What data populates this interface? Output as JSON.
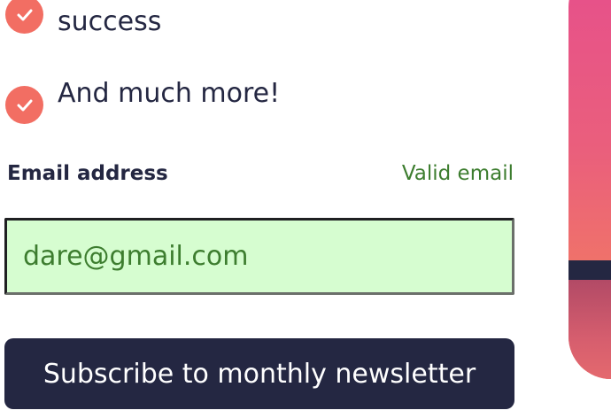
{
  "features": [
    {
      "text": "success"
    },
    {
      "text": "And much more!"
    }
  ],
  "form": {
    "email_label": "Email address",
    "validation_message": "Valid email",
    "email_value": "dare@gmail.com"
  },
  "subscribe": {
    "label": "Subscribe to monthly newsletter"
  },
  "colors": {
    "accent": "#f26e63",
    "dark_navy": "#242742",
    "success_text": "#3d7d2f",
    "success_bg": "#d6fdd0"
  },
  "icons": {
    "feature_check": "check-icon"
  }
}
